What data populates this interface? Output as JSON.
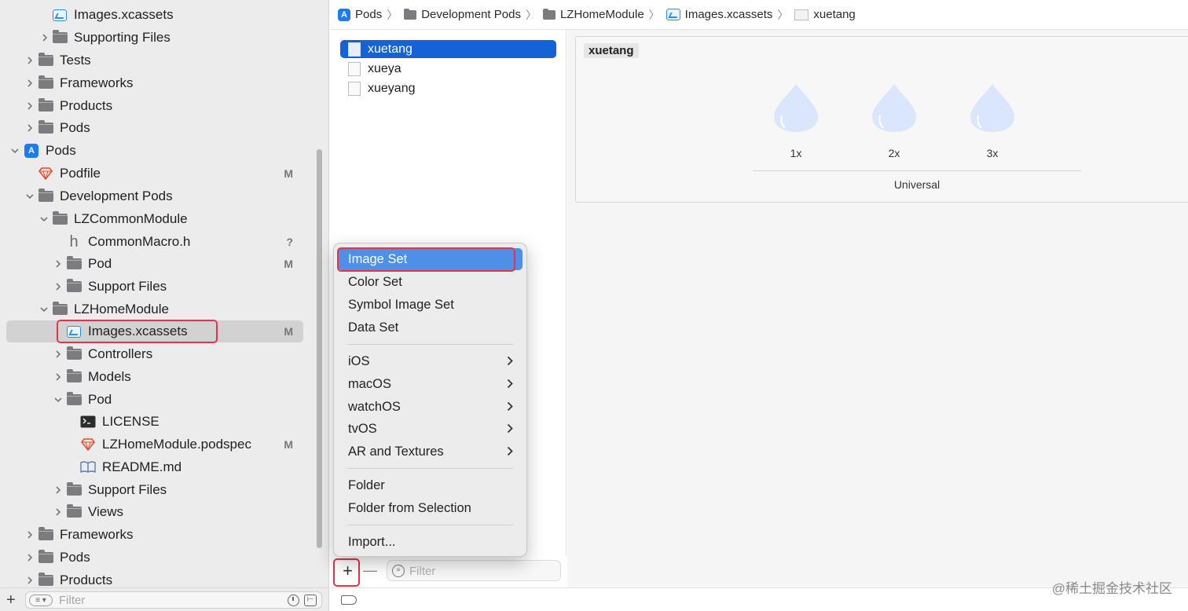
{
  "navigator": {
    "rows": [
      {
        "label": "Images.xcassets",
        "status": ""
      },
      {
        "label": "Supporting Files",
        "status": ""
      },
      {
        "label": "Tests",
        "status": ""
      },
      {
        "label": "Frameworks",
        "status": ""
      },
      {
        "label": "Products",
        "status": ""
      },
      {
        "label": "Pods",
        "status": ""
      },
      {
        "label": "Pods",
        "status": ""
      },
      {
        "label": "Podfile",
        "status": "M"
      },
      {
        "label": "Development Pods",
        "status": ""
      },
      {
        "label": "LZCommonModule",
        "status": ""
      },
      {
        "label": "CommonMacro.h",
        "status": "?"
      },
      {
        "label": "Pod",
        "status": "M"
      },
      {
        "label": "Support Files",
        "status": ""
      },
      {
        "label": "LZHomeModule",
        "status": ""
      },
      {
        "label": "Images.xcassets",
        "status": "M"
      },
      {
        "label": "Controllers",
        "status": ""
      },
      {
        "label": "Models",
        "status": ""
      },
      {
        "label": "Pod",
        "status": ""
      },
      {
        "label": "LICENSE",
        "status": ""
      },
      {
        "label": "LZHomeModule.podspec",
        "status": "M"
      },
      {
        "label": "README.md",
        "status": ""
      },
      {
        "label": "Support Files",
        "status": ""
      },
      {
        "label": "Views",
        "status": ""
      },
      {
        "label": "Frameworks",
        "status": ""
      },
      {
        "label": "Pods",
        "status": ""
      },
      {
        "label": "Products",
        "status": ""
      }
    ],
    "filter_placeholder": "Filter",
    "add_label": "+",
    "header_icon_glyph": "h"
  },
  "breadcrumb": {
    "items": [
      "Pods",
      "Development Pods",
      "LZHomeModule",
      "Images.xcassets",
      "xuetang"
    ]
  },
  "assets": {
    "items": [
      "xuetang",
      "xueya",
      "xueyang"
    ],
    "filter_placeholder": "Filter",
    "add_label": "+",
    "remove_label": "—"
  },
  "editor": {
    "set_name": "xuetang",
    "scales": [
      "1x",
      "2x",
      "3x"
    ],
    "device": "Universal"
  },
  "menu": {
    "items": [
      "Image Set",
      "Color Set",
      "Symbol Image Set",
      "Data Set",
      "iOS",
      "macOS",
      "watchOS",
      "tvOS",
      "AR and Textures",
      "Folder",
      "Folder from Selection",
      "Import..."
    ]
  },
  "watermark": "@稀土掘金技术社区",
  "colors": {
    "selection_blue": "#1463d6",
    "menu_highlight": "#4e8fe8",
    "annotation_red": "#e5344a",
    "git_status_gray": "#777777"
  }
}
